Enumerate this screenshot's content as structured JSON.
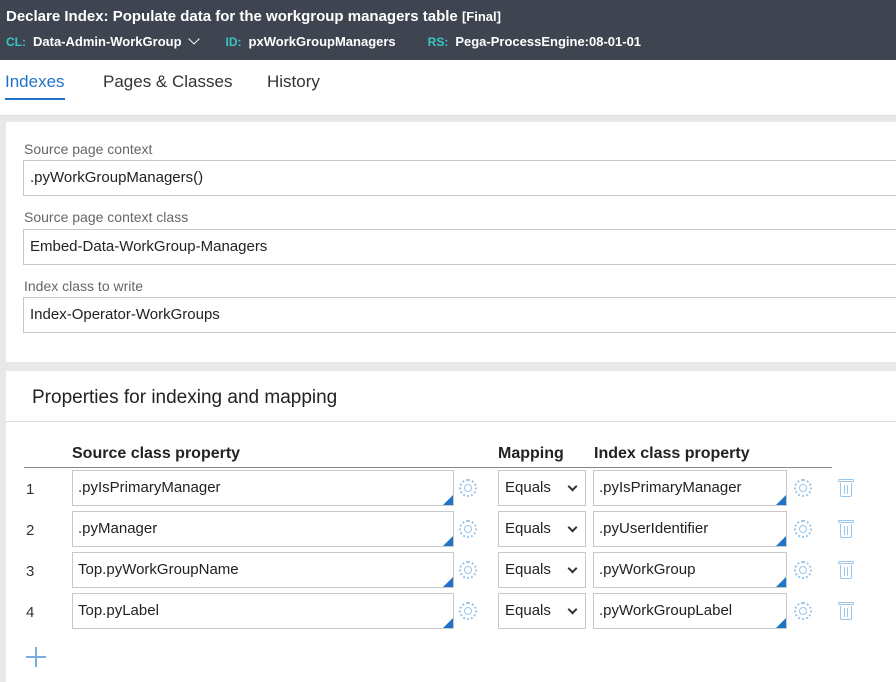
{
  "header": {
    "title": "Declare Index: Populate data for the workgroup managers table",
    "status": "[Final]",
    "cl_key": "CL:",
    "cl_value": "Data-Admin-WorkGroup",
    "id_key": "ID:",
    "id_value": "pxWorkGroupManagers",
    "rs_key": "RS:",
    "rs_value": "Pega-ProcessEngine:08-01-01"
  },
  "tabs": [
    {
      "label": "Indexes",
      "active": true
    },
    {
      "label": "Pages & Classes",
      "active": false
    },
    {
      "label": "History",
      "active": false
    }
  ],
  "fields": {
    "source_context_label": "Source page context",
    "source_context_value": ".pyWorkGroupManagers()",
    "source_class_label": "Source page context class",
    "source_class_value": "Embed-Data-WorkGroup-Managers",
    "index_class_label": "Index class to write",
    "index_class_value": "Index-Operator-WorkGroups"
  },
  "properties": {
    "title": "Properties for indexing and mapping",
    "col_source": "Source class property",
    "col_mapping": "Mapping",
    "col_index": "Index class property",
    "rows": [
      {
        "num": "1",
        "source": ".pyIsPrimaryManager",
        "mapping": "Equals",
        "index": ".pyIsPrimaryManager"
      },
      {
        "num": "2",
        "source": ".pyManager",
        "mapping": "Equals",
        "index": ".pyUserIdentifier"
      },
      {
        "num": "3",
        "source": "Top.pyWorkGroupName",
        "mapping": "Equals",
        "index": ".pyWorkGroup"
      },
      {
        "num": "4",
        "source": "Top.pyLabel",
        "mapping": "Equals",
        "index": ".pyWorkGroupLabel"
      }
    ]
  },
  "icons": {
    "cl_dropdown": "chevron-down-icon",
    "gear": "gear-icon",
    "delete": "trash-icon",
    "add": "plus-icon"
  },
  "colors": {
    "header_bg": "#3f4550",
    "key_accent": "#36c6c6",
    "tab_active": "#1f73c9"
  }
}
